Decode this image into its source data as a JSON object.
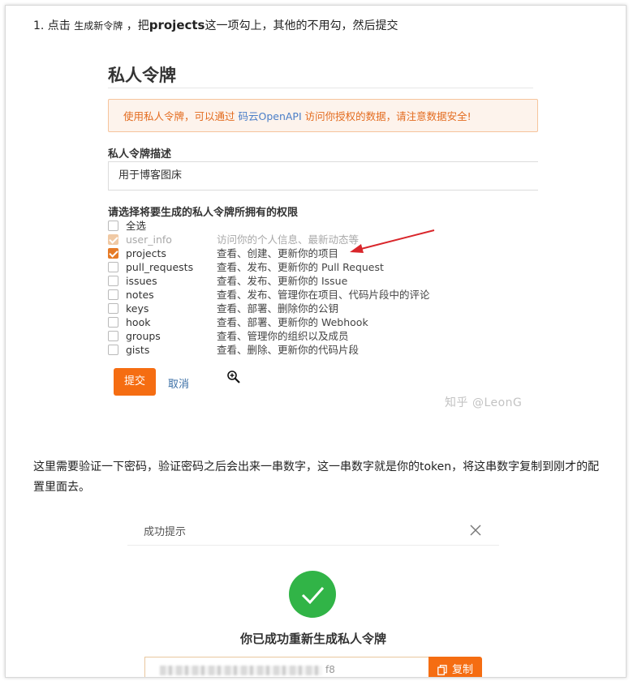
{
  "step": {
    "prefix": "1. 点击 ",
    "target": "生成新令牌",
    "middle": " ，把",
    "emphasis": "projects",
    "suffix": "这一项勾上，其他的不用勾，然后提交"
  },
  "form": {
    "title": "私人令牌",
    "alert_before": "使用私人令牌，可以通过 ",
    "alert_link": "码云OpenAPI",
    "alert_after": " 访问你授权的数据，请注意数据安全!",
    "desc_label": "私人令牌描述",
    "desc_value": "用于博客图床",
    "perm_label": "请选择将要生成的私人令牌所拥有的权限",
    "permissions": [
      {
        "name": "全选",
        "desc": "",
        "state": "unchecked"
      },
      {
        "name": "user_info",
        "desc": "访问你的个人信息、最新动态等",
        "state": "disabled-checked"
      },
      {
        "name": "projects",
        "desc": "查看、创建、更新你的项目",
        "state": "checked"
      },
      {
        "name": "pull_requests",
        "desc": "查看、发布、更新你的 Pull Request",
        "state": "unchecked"
      },
      {
        "name": "issues",
        "desc": "查看、发布、更新你的 Issue",
        "state": "unchecked"
      },
      {
        "name": "notes",
        "desc": "查看、发布、管理你在项目、代码片段中的评论",
        "state": "unchecked"
      },
      {
        "name": "keys",
        "desc": "查看、部署、删除你的公钥",
        "state": "unchecked"
      },
      {
        "name": "hook",
        "desc": "查看、部署、更新你的 Webhook",
        "state": "unchecked"
      },
      {
        "name": "groups",
        "desc": "查看、管理你的组织以及成员",
        "state": "unchecked"
      },
      {
        "name": "gists",
        "desc": "查看、删除、更新你的代码片段",
        "state": "unchecked"
      }
    ],
    "submit_label": "提交",
    "cancel_label": "取消",
    "watermark": "知乎 @LeonG"
  },
  "paragraph": "这里需要验证一下密码，验证密码之后会出来一串数字，这一串数字就是你的token，将这串数字复制到刚才的配置里面去。",
  "dialog": {
    "title": "成功提示",
    "success_text": "你已成功重新生成私人令牌",
    "token_suffix": "f8",
    "copy_label": "复制"
  },
  "colors": {
    "accent": "#f56d12",
    "success": "#31b447",
    "link": "#3a6ea5"
  }
}
